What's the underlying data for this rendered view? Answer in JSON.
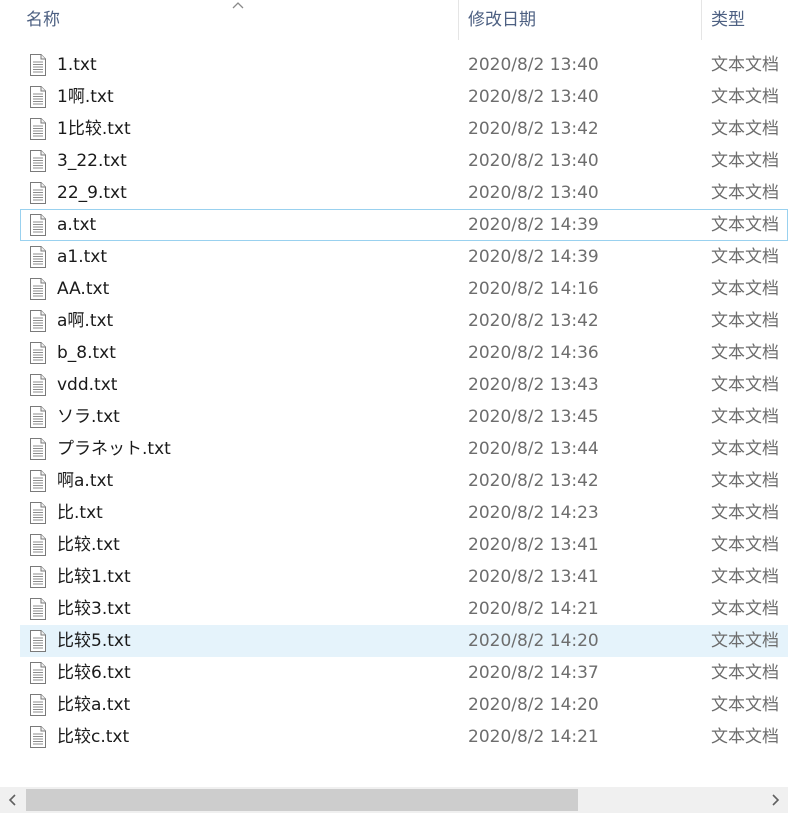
{
  "columns": {
    "name": "名称",
    "date": "修改日期",
    "type": "类型"
  },
  "icons": {
    "file": "text-file-icon",
    "sort": "chevron-up-icon",
    "scroll_left": "chevron-left-icon",
    "scroll_right": "chevron-right-icon"
  },
  "files": [
    {
      "name": "1.txt",
      "date": "2020/8/2 13:40",
      "type": "文本文档"
    },
    {
      "name": "1啊.txt",
      "date": "2020/8/2 13:40",
      "type": "文本文档"
    },
    {
      "name": "1比较.txt",
      "date": "2020/8/2 13:42",
      "type": "文本文档"
    },
    {
      "name": "3_22.txt",
      "date": "2020/8/2 13:40",
      "type": "文本文档"
    },
    {
      "name": "22_9.txt",
      "date": "2020/8/2 13:40",
      "type": "文本文档"
    },
    {
      "name": "a.txt",
      "date": "2020/8/2 14:39",
      "type": "文本文档"
    },
    {
      "name": "a1.txt",
      "date": "2020/8/2 14:39",
      "type": "文本文档"
    },
    {
      "name": "AA.txt",
      "date": "2020/8/2 14:16",
      "type": "文本文档"
    },
    {
      "name": "a啊.txt",
      "date": "2020/8/2 13:42",
      "type": "文本文档"
    },
    {
      "name": "b_8.txt",
      "date": "2020/8/2 14:36",
      "type": "文本文档"
    },
    {
      "name": "vdd.txt",
      "date": "2020/8/2 13:43",
      "type": "文本文档"
    },
    {
      "name": "ソラ.txt",
      "date": "2020/8/2 13:45",
      "type": "文本文档"
    },
    {
      "name": "プラネット.txt",
      "date": "2020/8/2 13:44",
      "type": "文本文档"
    },
    {
      "name": "啊a.txt",
      "date": "2020/8/2 13:42",
      "type": "文本文档"
    },
    {
      "name": "比.txt",
      "date": "2020/8/2 14:23",
      "type": "文本文档"
    },
    {
      "name": "比较.txt",
      "date": "2020/8/2 13:41",
      "type": "文本文档"
    },
    {
      "name": "比较1.txt",
      "date": "2020/8/2 13:41",
      "type": "文本文档"
    },
    {
      "name": "比较3.txt",
      "date": "2020/8/2 14:21",
      "type": "文本文档"
    },
    {
      "name": "比较5.txt",
      "date": "2020/8/2 14:20",
      "type": "文本文档"
    },
    {
      "name": "比较6.txt",
      "date": "2020/8/2 14:37",
      "type": "文本文档"
    },
    {
      "name": "比较a.txt",
      "date": "2020/8/2 14:20",
      "type": "文本文档"
    },
    {
      "name": "比较c.txt",
      "date": "2020/8/2 14:21",
      "type": "文本文档"
    }
  ],
  "state": {
    "focused_index": 5,
    "selected_index": 18,
    "horizontal_scroll_fraction": 0.0,
    "horizontal_visible_fraction": 0.75
  },
  "colors": {
    "header_text": "#4d6082",
    "selection": "#e5f3fb",
    "focus_border": "#99d1ef",
    "scroll_track": "#f0f0f0",
    "scroll_thumb": "#cdcdcd"
  }
}
